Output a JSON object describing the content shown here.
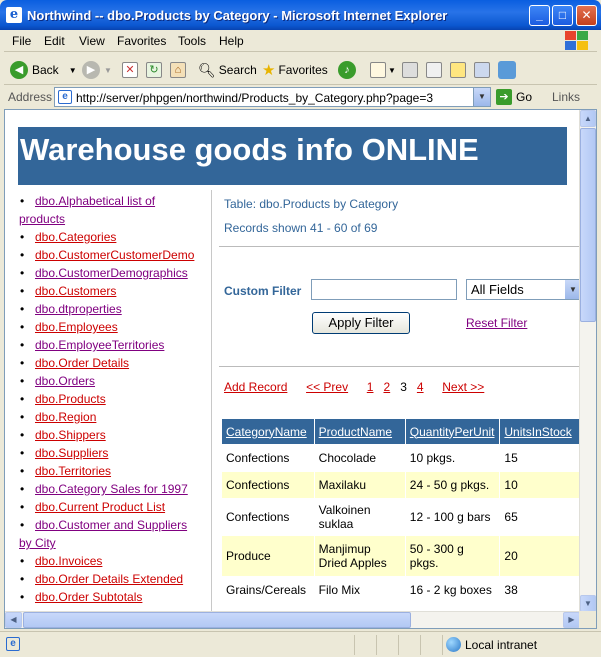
{
  "window": {
    "title": "Northwind -- dbo.Products by Category - Microsoft Internet Explorer",
    "minimize": "_",
    "maximize": "□",
    "close": "✕"
  },
  "menu": [
    "File",
    "Edit",
    "View",
    "Favorites",
    "Tools",
    "Help"
  ],
  "toolbar": {
    "back": "Back",
    "search": "Search",
    "favorites": "Favorites"
  },
  "address": {
    "label": "Address",
    "url": "http://server/phpgen/northwind/Products_by_Category.php?page=3",
    "go": "Go",
    "links": "Links"
  },
  "page": {
    "banner": "Warehouse goods info ONLINE",
    "table_caption": "Table: dbo.Products by Category",
    "records_shown": "Records shown 41 - 60 of 69",
    "filter": {
      "label": "Custom Filter",
      "input_value": "",
      "field_select": "All Fields",
      "apply": "Apply Filter",
      "reset": "Reset Filter"
    },
    "pager": {
      "add_record": "Add Record",
      "prev": "<< Prev",
      "pages": [
        "1",
        "2",
        "3",
        "4"
      ],
      "current": "3",
      "next": "Next >>"
    }
  },
  "sidebar": {
    "items": [
      {
        "label": "dbo.Alphabetical list of",
        "rest": "products",
        "visited": true
      },
      {
        "label": "dbo.Categories",
        "visited": false
      },
      {
        "label": "dbo.CustomerCustomerDemo",
        "visited": false
      },
      {
        "label": "dbo.CustomerDemographics",
        "visited": true
      },
      {
        "label": "dbo.Customers",
        "visited": false
      },
      {
        "label": "dbo.dtproperties",
        "visited": true
      },
      {
        "label": "dbo.Employees",
        "visited": false
      },
      {
        "label": "dbo.EmployeeTerritories",
        "visited": true
      },
      {
        "label": "dbo.Order Details",
        "visited": false
      },
      {
        "label": "dbo.Orders",
        "visited": true
      },
      {
        "label": "dbo.Products",
        "visited": false
      },
      {
        "label": "dbo.Region",
        "visited": false
      },
      {
        "label": "dbo.Shippers",
        "visited": false
      },
      {
        "label": "dbo.Suppliers",
        "visited": false
      },
      {
        "label": "dbo.Territories",
        "visited": false
      },
      {
        "label": "dbo.Category Sales for 1997",
        "visited": true
      },
      {
        "label": "dbo.Current Product List",
        "visited": false
      },
      {
        "label": "dbo.Customer and Suppliers",
        "rest": "by City",
        "visited": true
      },
      {
        "label": "dbo.Invoices",
        "visited": false
      },
      {
        "label": "dbo.Order Details Extended",
        "visited": false
      },
      {
        "label": "dbo.Order Subtotals",
        "visited": false
      }
    ]
  },
  "grid": {
    "columns": [
      "CategoryName",
      "ProductName",
      "QuantityPerUnit",
      "UnitsInStock"
    ],
    "rows": [
      [
        "Confections",
        "Chocolade",
        "10 pkgs.",
        "15"
      ],
      [
        "Confections",
        "Maxilaku",
        "24 - 50 g pkgs.",
        "10"
      ],
      [
        "Confections",
        "Valkoinen suklaa",
        "12 - 100 g bars",
        "65"
      ],
      [
        "Produce",
        "Manjimup Dried Apples",
        "50 - 300 g pkgs.",
        "20"
      ],
      [
        "Grains/Cereals",
        "Filo Mix",
        "16 - 2 kg boxes",
        "38"
      ]
    ]
  },
  "status": {
    "zone": "Local intranet"
  }
}
